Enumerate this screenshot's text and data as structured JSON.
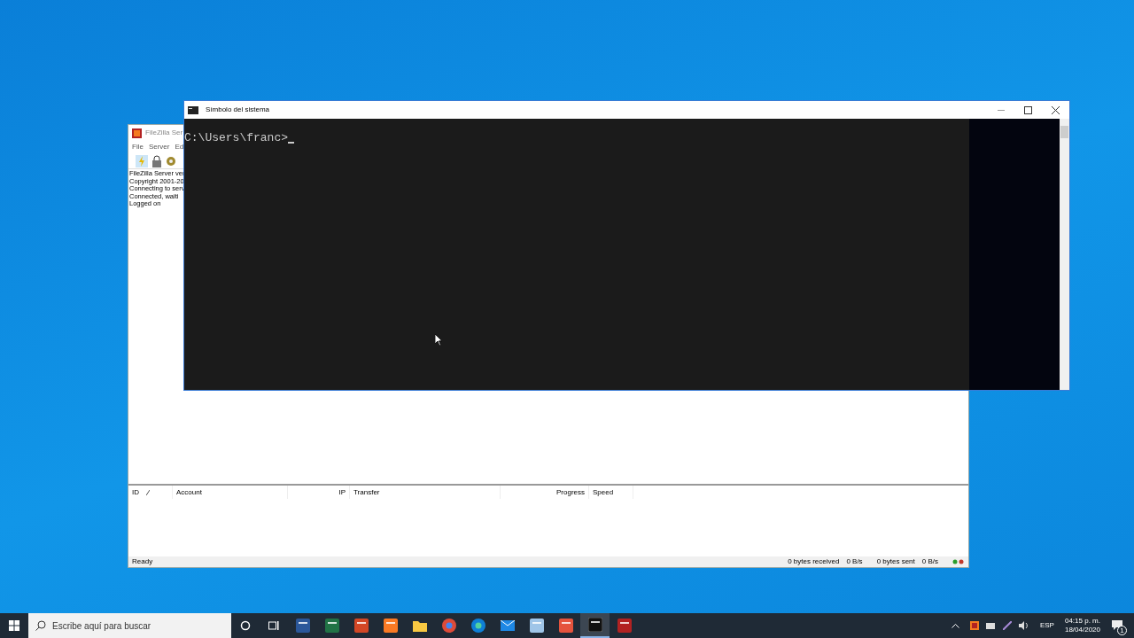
{
  "filezilla": {
    "title": "FileZilla Ser",
    "menu": [
      "File",
      "Server",
      "Ed"
    ],
    "log": [
      "FileZilla Server ver",
      "Copyright 2001-20",
      "Connecting to serv",
      "Connected, waiti",
      "Logged on"
    ],
    "columns": [
      {
        "label": "ID",
        "sorted": true
      },
      {
        "label": "Account",
        "sorted": false
      },
      {
        "label": "IP",
        "sorted": false
      },
      {
        "label": "Transfer",
        "sorted": false
      },
      {
        "label": "Progress",
        "sorted": false
      },
      {
        "label": "Speed",
        "sorted": false
      }
    ],
    "status_bar": {
      "status": "Ready",
      "received": "0 bytes received",
      "received_rate": "0 B/s",
      "sent": "0 bytes sent",
      "sent_rate": "0 B/s"
    }
  },
  "console": {
    "title": "Símbolo del sistema",
    "prompt": "C:\\Users\\franc>"
  },
  "taskbar": {
    "search": {
      "placeholder": "Escribe aquí para buscar"
    },
    "apps": [
      {
        "kind": "word",
        "selected": false
      },
      {
        "kind": "excel",
        "selected": false
      },
      {
        "kind": "powerpoint",
        "selected": false
      },
      {
        "kind": "xampp",
        "selected": false
      },
      {
        "kind": "folder",
        "selected": false
      },
      {
        "kind": "chrome",
        "selected": false
      },
      {
        "kind": "edge",
        "selected": false
      },
      {
        "kind": "mail",
        "selected": false
      },
      {
        "kind": "notes",
        "selected": false
      },
      {
        "kind": "codeapp",
        "selected": false
      },
      {
        "kind": "console",
        "selected": true
      },
      {
        "kind": "filezilla",
        "selected": false
      }
    ],
    "language": "ESP",
    "time": "04:15 p. m.",
    "date": "18/04/2020",
    "notifications": "1"
  }
}
